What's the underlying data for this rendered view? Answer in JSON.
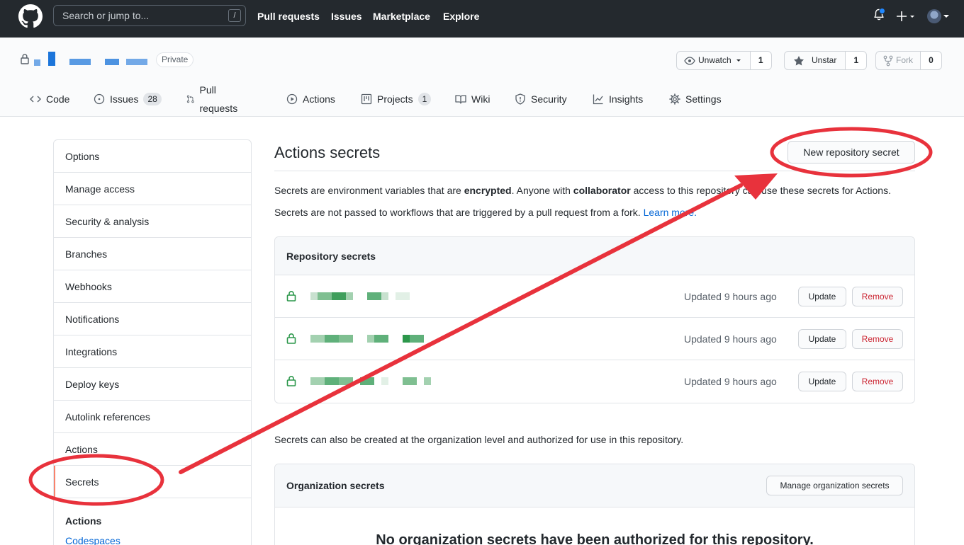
{
  "header": {
    "search_placeholder": "Search or jump to...",
    "search_shortcut": "/",
    "nav": [
      "Pull requests",
      "Issues",
      "Marketplace",
      "Explore"
    ]
  },
  "repo": {
    "visibility": "Private",
    "watch_label": "Unwatch",
    "watch_count": "1",
    "star_label": "Unstar",
    "star_count": "1",
    "fork_label": "Fork",
    "fork_count": "0"
  },
  "tabs": [
    {
      "label": "Code",
      "icon": "code-icon"
    },
    {
      "label": "Issues",
      "count": "28",
      "icon": "issue-opened-icon"
    },
    {
      "label": "Pull requests",
      "icon": "git-pull-request-icon"
    },
    {
      "label": "Actions",
      "icon": "play-icon"
    },
    {
      "label": "Projects",
      "count": "1",
      "icon": "project-icon"
    },
    {
      "label": "Wiki",
      "icon": "book-icon"
    },
    {
      "label": "Security",
      "icon": "shield-icon"
    },
    {
      "label": "Insights",
      "icon": "graph-icon"
    },
    {
      "label": "Settings",
      "icon": "gear-icon"
    }
  ],
  "sidebar": {
    "items": [
      "Options",
      "Manage access",
      "Security & analysis",
      "Branches",
      "Webhooks",
      "Notifications",
      "Integrations",
      "Deploy keys",
      "Autolink references",
      "Actions",
      "Secrets"
    ],
    "selected": "Secrets",
    "section_heading": "Actions",
    "section_link": "Codespaces"
  },
  "main": {
    "title": "Actions secrets",
    "new_secret_button": "New repository secret",
    "intro_1": "Secrets are environment variables that are",
    "intro_1_bold_1": "encrypted",
    "intro_1_mid": ". Anyone with",
    "intro_1_bold_2": "collaborator",
    "intro_1_end": "access to this repository can use these secrets for Actions.",
    "intro_2": "Secrets are not passed to workflows that are triggered by a pull request from a fork.",
    "learn_more": "Learn more.",
    "repo_secrets": {
      "heading": "Repository secrets",
      "rows": [
        {
          "updated": "Updated 9 hours ago",
          "update": "Update",
          "remove": "Remove"
        },
        {
          "updated": "Updated 9 hours ago",
          "update": "Update",
          "remove": "Remove"
        },
        {
          "updated": "Updated 9 hours ago",
          "update": "Update",
          "remove": "Remove"
        }
      ]
    },
    "org_note": "Secrets can also be created at the organization level and authorized for use in this repository.",
    "org_secrets": {
      "heading": "Organization secrets",
      "manage_button": "Manage organization secrets",
      "empty_title": "No organization secrets have been authorized for this repository."
    }
  },
  "colors": {
    "header_bg": "#24292e",
    "link": "#0366d6",
    "danger": "#cb2431",
    "annotation": "#e8323c",
    "secret_green": "#2c974b"
  }
}
